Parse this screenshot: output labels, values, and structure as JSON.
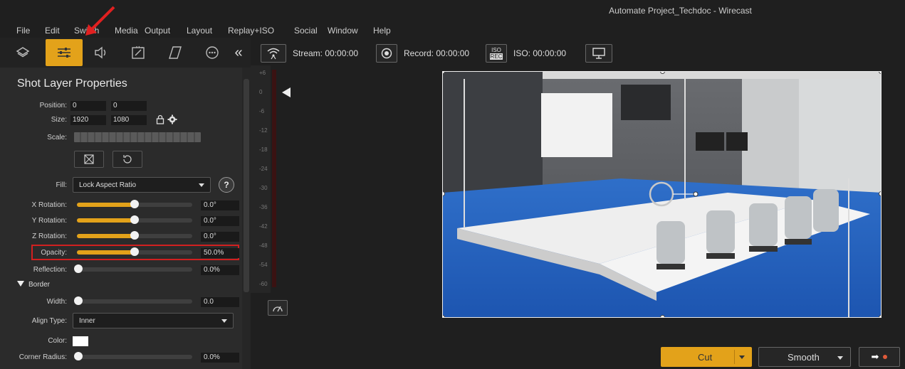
{
  "window": {
    "title": "Automate Project_Techdoc - Wirecast"
  },
  "menu": [
    "File",
    "Edit",
    "Switch",
    "Media",
    "Output",
    "Layout",
    "Replay+ISO",
    "Social",
    "Window",
    "Help"
  ],
  "toolbar": {
    "icons": [
      "layers-icon",
      "sliders-icon",
      "audio-icon",
      "magic-icon",
      "skew-icon",
      "more-icon",
      "collapse-icon"
    ],
    "active": "sliders-icon"
  },
  "props": {
    "title": "Shot Layer Properties",
    "position": {
      "label": "Position:",
      "x": "0",
      "y": "0"
    },
    "size": {
      "label": "Size:",
      "w": "1920",
      "h": "1080"
    },
    "scale": {
      "label": "Scale:"
    },
    "fill": {
      "label": "Fill:",
      "value": "Lock Aspect Ratio",
      "help": "?"
    },
    "x_rotation": {
      "label": "X Rotation:",
      "value": "0.0°",
      "level": 0.5
    },
    "y_rotation": {
      "label": "Y Rotation:",
      "value": "0.0°",
      "level": 0.5
    },
    "z_rotation": {
      "label": "Z Rotation:",
      "value": "0.0°",
      "level": 0.5
    },
    "opacity": {
      "label": "Opacity:",
      "value": "50.0%",
      "level": 0.5
    },
    "reflection": {
      "label": "Reflection:",
      "value": "0.0%",
      "level": 0
    },
    "border": {
      "label": "Border"
    },
    "width": {
      "label": "Width:",
      "value": "0.0",
      "level": 0
    },
    "align_type": {
      "label": "Align Type:",
      "value": "Inner"
    },
    "color": {
      "label": "Color:",
      "value": "#ffffff"
    },
    "corner_radius": {
      "label": "Corner Radius:",
      "value": "0.0%",
      "level": 0
    }
  },
  "meter": {
    "ticks": [
      "+6",
      "0",
      "-6",
      "-12",
      "-18",
      "-24",
      "-30",
      "-36",
      "-42",
      "-48",
      "-54",
      "-60"
    ]
  },
  "status": {
    "stream": "Stream: 00:00:00",
    "record": "Record: 00:00:00",
    "iso_label_top": "ISO",
    "iso_label_bottom": "REC",
    "iso": "ISO: 00:00:00"
  },
  "transition": {
    "cut": "Cut",
    "smooth": "Smooth",
    "go": "➡"
  },
  "colors": {
    "accent": "#e3a21a",
    "highlight": "#d12020",
    "record_dot": "#e05a3a"
  }
}
